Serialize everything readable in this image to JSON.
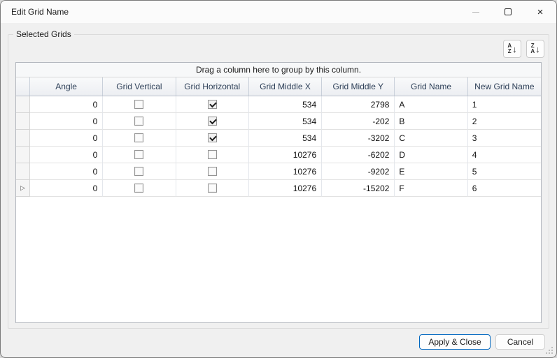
{
  "window": {
    "title": "Edit Grid Name"
  },
  "icons": {
    "close": "×",
    "sort_arrow": "↓",
    "row_focus": "▷"
  },
  "groupbox": {
    "label": "Selected Grids"
  },
  "toolbar": {
    "sort_ascending": {
      "top": "A",
      "bottom": "Z"
    },
    "sort_descending": {
      "top": "Z",
      "bottom": "A"
    }
  },
  "grid": {
    "group_by_hint": "Drag a column here to group by this column.",
    "columns": [
      "Angle",
      "Grid Vertical",
      "Grid Horizontal",
      "Grid Middle X",
      "Grid Middle Y",
      "Grid Name",
      "New Grid Name"
    ],
    "rows": [
      {
        "angle": "0",
        "grid_vertical": false,
        "grid_horizontal": true,
        "grid_middle_x": "534",
        "grid_middle_y": "2798",
        "grid_name": "A",
        "new_grid_name": "1"
      },
      {
        "angle": "0",
        "grid_vertical": false,
        "grid_horizontal": true,
        "grid_middle_x": "534",
        "grid_middle_y": "-202",
        "grid_name": "B",
        "new_grid_name": "2"
      },
      {
        "angle": "0",
        "grid_vertical": false,
        "grid_horizontal": true,
        "grid_middle_x": "534",
        "grid_middle_y": "-3202",
        "grid_name": "C",
        "new_grid_name": "3"
      },
      {
        "angle": "0",
        "grid_vertical": false,
        "grid_horizontal": false,
        "grid_middle_x": "10276",
        "grid_middle_y": "-6202",
        "grid_name": "D",
        "new_grid_name": "4"
      },
      {
        "angle": "0",
        "grid_vertical": false,
        "grid_horizontal": false,
        "grid_middle_x": "10276",
        "grid_middle_y": "-9202",
        "grid_name": "E",
        "new_grid_name": "5"
      },
      {
        "angle": "0",
        "grid_vertical": false,
        "grid_horizontal": false,
        "grid_middle_x": "10276",
        "grid_middle_y": "-15202",
        "grid_name": "F",
        "new_grid_name": "6"
      }
    ]
  },
  "footer": {
    "apply_close_label": "Apply & Close",
    "cancel_label": "Cancel"
  },
  "colors": {
    "accent": "#0067c0",
    "header_text": "#2e4058",
    "dialog_bg": "#f0f0f0"
  }
}
